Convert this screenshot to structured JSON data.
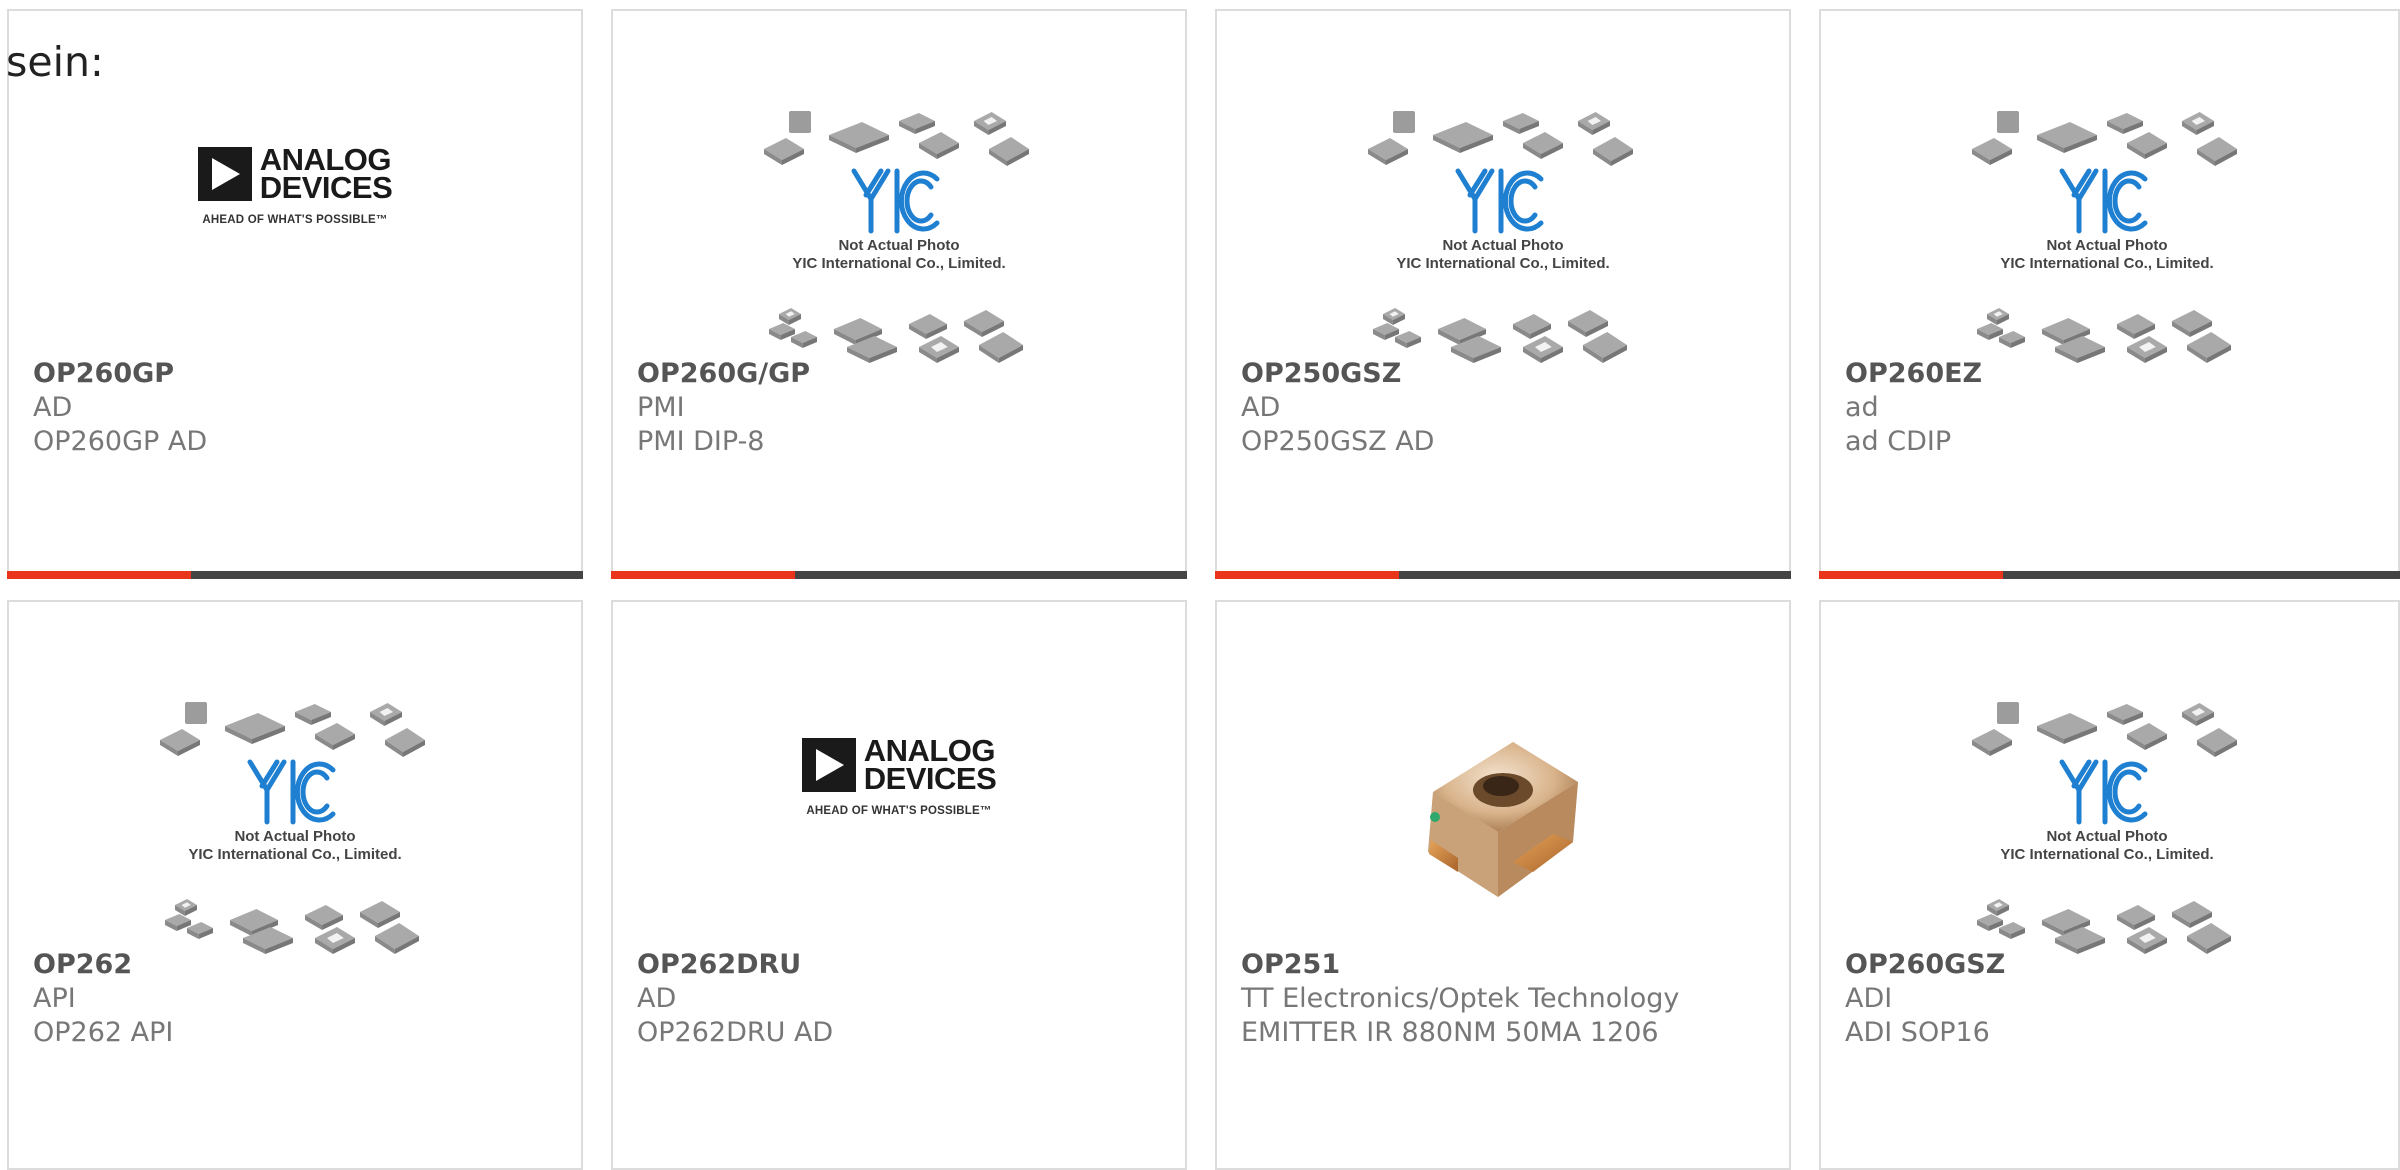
{
  "prefix_text": "sein:",
  "colors": {
    "accent": "#e8351c",
    "bar": "#444444",
    "border": "#dcdcdc"
  },
  "placeholder": {
    "line1": "Not Actual Photo",
    "line2": "YIC International Co., Limited.",
    "logo": "YIC"
  },
  "adi_logo": {
    "word1": "ANALOG",
    "word2": "DEVICES",
    "tagline": "AHEAD OF WHAT'S POSSIBLE™"
  },
  "products": [
    {
      "part": "OP260GP",
      "maker": "AD",
      "desc": "OP260GP AD",
      "image": "analog-devices-logo",
      "has_bar": true
    },
    {
      "part": "OP260G/GP",
      "maker": "PMI",
      "desc": "PMI DIP-8",
      "image": "yic-placeholder",
      "has_bar": true
    },
    {
      "part": "OP250GSZ",
      "maker": "AD",
      "desc": "OP250GSZ AD",
      "image": "yic-placeholder",
      "has_bar": true
    },
    {
      "part": "OP260EZ",
      "maker": "ad",
      "desc": "ad CDIP",
      "image": "yic-placeholder",
      "has_bar": true
    },
    {
      "part": "OP262",
      "maker": "API",
      "desc": "OP262 API",
      "image": "yic-placeholder",
      "has_bar": false
    },
    {
      "part": "OP262DRU",
      "maker": "AD",
      "desc": "OP262DRU AD",
      "image": "analog-devices-logo",
      "has_bar": false
    },
    {
      "part": "OP251",
      "maker": "TT Electronics/Optek Technology",
      "desc": "EMITTER IR 880NM 50MA 1206",
      "image": "smd-led-photo",
      "has_bar": false
    },
    {
      "part": "OP260GSZ",
      "maker": "ADI",
      "desc": "ADI SOP16",
      "image": "yic-placeholder",
      "has_bar": false
    }
  ]
}
